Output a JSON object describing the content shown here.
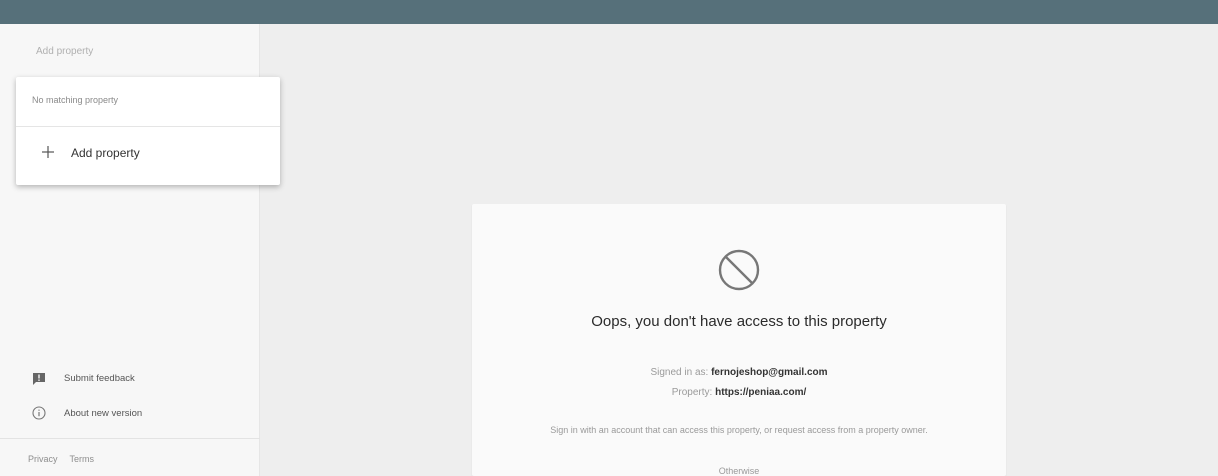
{
  "search": {
    "placeholder": "Add property"
  },
  "dropdown": {
    "empty_text": "No matching property",
    "add_label": "Add property"
  },
  "sidebar": {
    "submit_feedback": "Submit feedback",
    "about_version": "About new version",
    "privacy": "Privacy",
    "terms": "Terms"
  },
  "access_card": {
    "title": "Oops, you don't have access to this property",
    "signed_in_label": "Signed in as:",
    "signed_in_value": "fernojeshop@gmail.com",
    "property_label": "Property:",
    "property_value": "https://peniaa.com/",
    "description": "Sign in with an account that can access this property, or request access from a property owner.",
    "more": "Otherwise"
  },
  "colors": {
    "topbar": "#56707a",
    "sidebar": "#f7f7f7",
    "main_bg": "#eeeeee",
    "card": "#fafafa"
  }
}
